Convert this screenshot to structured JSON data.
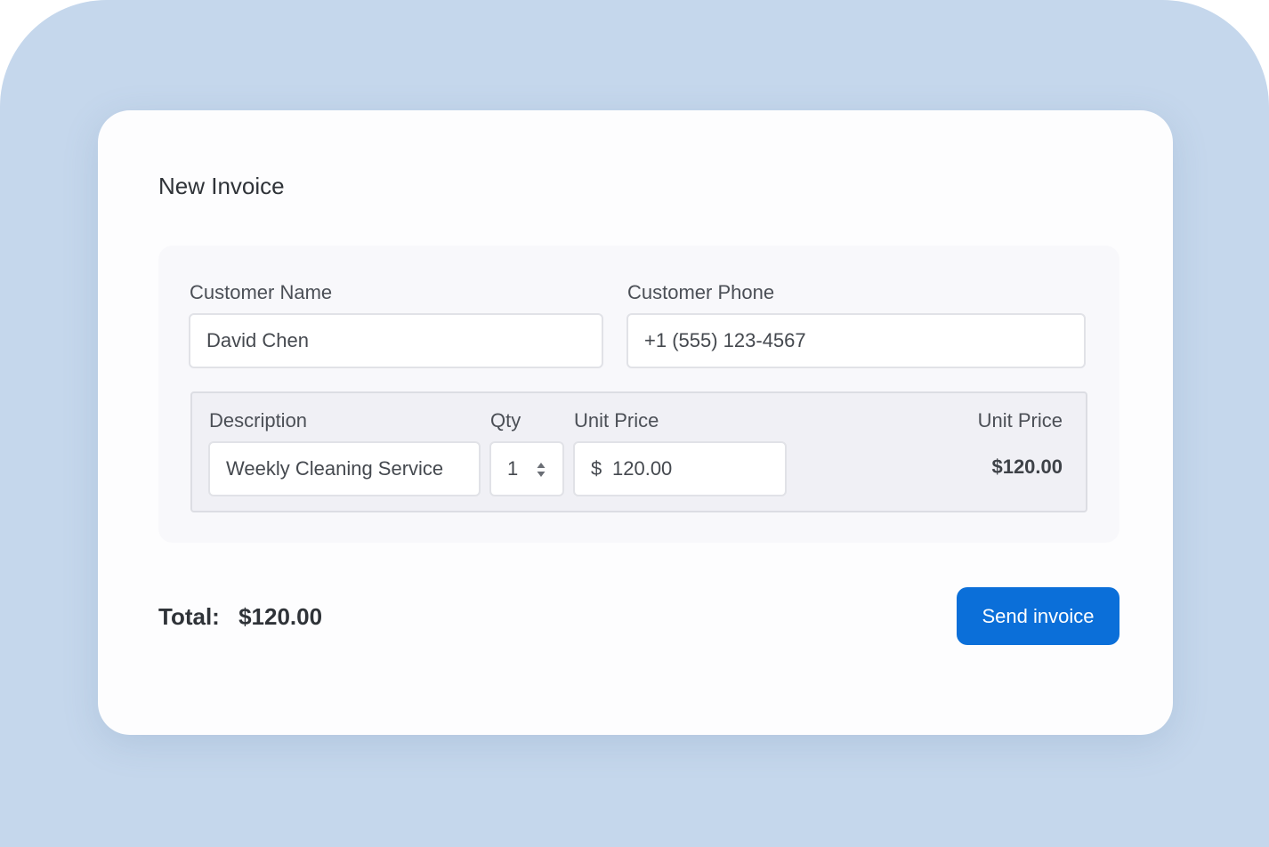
{
  "invoice": {
    "title": "New Invoice",
    "customer_name": {
      "label": "Customer Name",
      "value": "David Chen"
    },
    "customer_phone": {
      "label": "Customer Phone",
      "value": "+1 (555) 123-4567"
    },
    "line_item": {
      "description_label": "Description",
      "description_value": "Weekly Cleaning Service",
      "qty_label": "Qty",
      "qty_value": "1",
      "unit_price_label": "Unit Price",
      "currency_symbol": "$",
      "unit_price_value": "120.00",
      "line_total_label": "Unit Price",
      "line_total_value": "$120.00"
    },
    "total_label": "Total:",
    "total_value": "$120.00",
    "send_label": "Send invoice"
  },
  "icons": {
    "qty_stepper": "stepper-arrows-icon"
  },
  "colors": {
    "backdrop": "#c5d7ec",
    "card": "#fdfdfe",
    "accent": "#0b6fd9"
  }
}
